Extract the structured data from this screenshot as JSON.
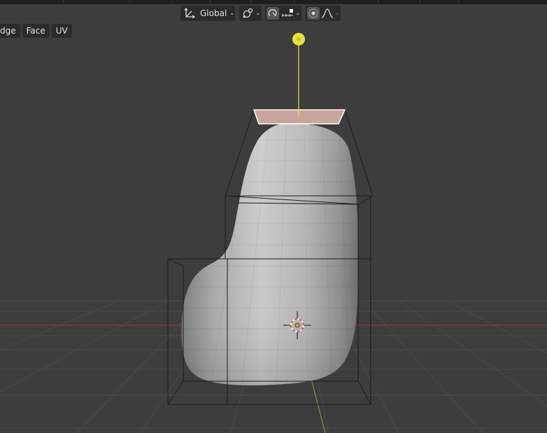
{
  "header": {
    "orientation": {
      "label": "Global",
      "icon": "transform-orientation-icon"
    },
    "pivot": {
      "icon": "pivot-point-icon"
    },
    "snap": {
      "icon": "snap-magnet-icon",
      "target_icon": "snap-increment-icon"
    },
    "proportional": {
      "icon": "proportional-editing-icon",
      "falloff_icon": "falloff-smooth-icon"
    }
  },
  "mode_menu": {
    "items": [
      "dge",
      "Face",
      "UV"
    ]
  },
  "colors": {
    "background": "#3d3d3d",
    "grid": "#4a4a4a",
    "x_axis": "#8a3a3a",
    "y_axis": "#7a9a2a",
    "lamp": "#e8e23a",
    "mesh": "#bdbdbd",
    "camera_plane": "#c8a59c",
    "cursor_red": "#e03030"
  }
}
